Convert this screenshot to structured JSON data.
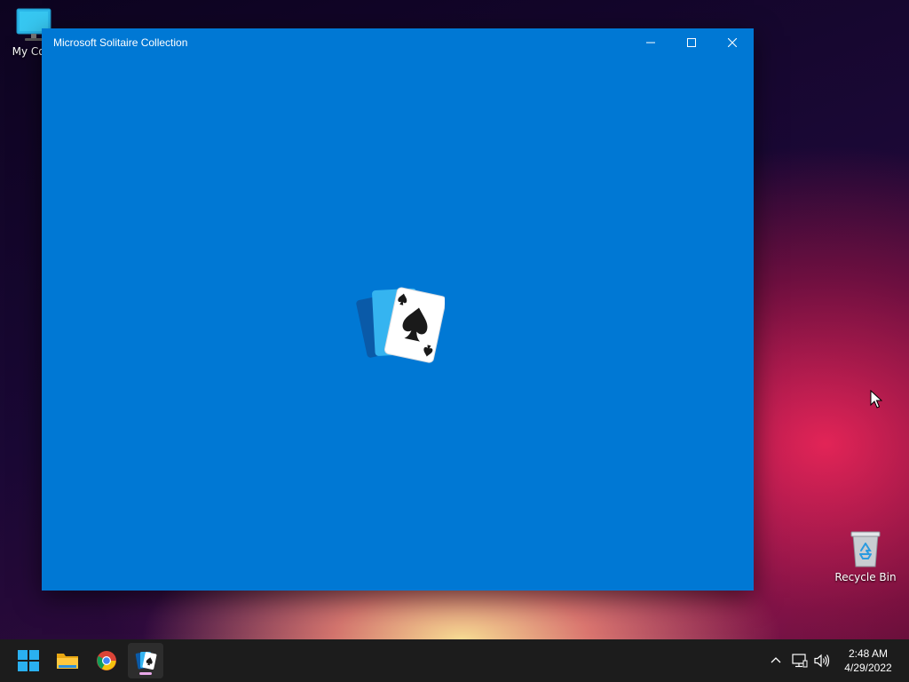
{
  "desktop": {
    "icons": [
      {
        "label": "My Com",
        "icon": "computer-icon"
      },
      {
        "label": "Recycle Bin",
        "icon": "recycle-bin-icon"
      }
    ]
  },
  "window": {
    "title": "Microsoft Solitaire Collection",
    "background_color": "#0078d4",
    "controls": {
      "minimize_icon": "minimize-icon",
      "maximize_icon": "maximize-icon",
      "close_icon": "close-icon"
    },
    "splash_icon": "solitaire-logo-icon"
  },
  "taskbar": {
    "apps": [
      {
        "name": "start",
        "icon": "windows-start-icon"
      },
      {
        "name": "file-explorer",
        "icon": "folder-icon"
      },
      {
        "name": "chrome",
        "icon": "chrome-icon"
      },
      {
        "name": "solitaire",
        "icon": "solitaire-icon",
        "active": true
      }
    ],
    "tray": {
      "icons": [
        "chevron-up-icon",
        "network-icon",
        "volume-icon"
      ]
    },
    "clock": {
      "time": "2:48 AM",
      "date": "4/29/2022"
    }
  }
}
